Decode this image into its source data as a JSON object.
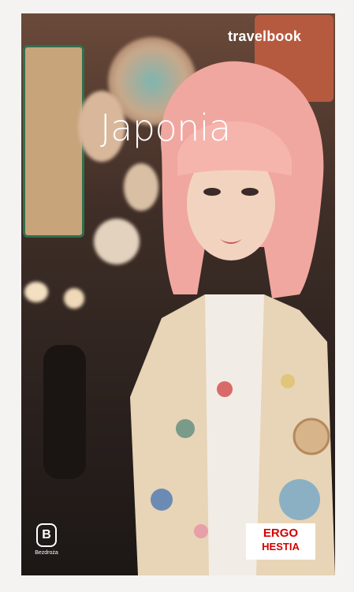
{
  "cover": {
    "brand": "travelbook",
    "title": "Japonia",
    "publisher": "Bezdroża",
    "sponsor_line1": "ERGO",
    "sponsor_line2": "HESTIA"
  },
  "icons": {
    "publisher_logo": "publisher-logo-icon",
    "sponsor_logo": "ergo-hestia-logo"
  },
  "colors": {
    "title": "#ffffff",
    "sponsor_red": "#d40000",
    "hair": "#f0a7a0"
  }
}
